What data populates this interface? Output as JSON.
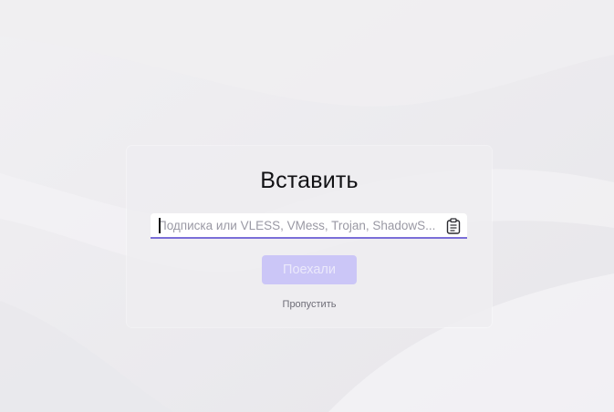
{
  "dialog": {
    "title": "Вставить",
    "input": {
      "value": "",
      "placeholder": "Подписка или VLESS, VMess, Trojan, ShadowS..."
    },
    "paste_icon": "clipboard-icon",
    "submit_label": "Поехали",
    "submit_enabled": false,
    "skip_label": "Пропустить"
  },
  "colors": {
    "background": "#eceaee",
    "accent_underline": "#7b6fd8",
    "button_disabled_bg": "#cbc6f7",
    "button_disabled_text": "#ebe9fb"
  }
}
